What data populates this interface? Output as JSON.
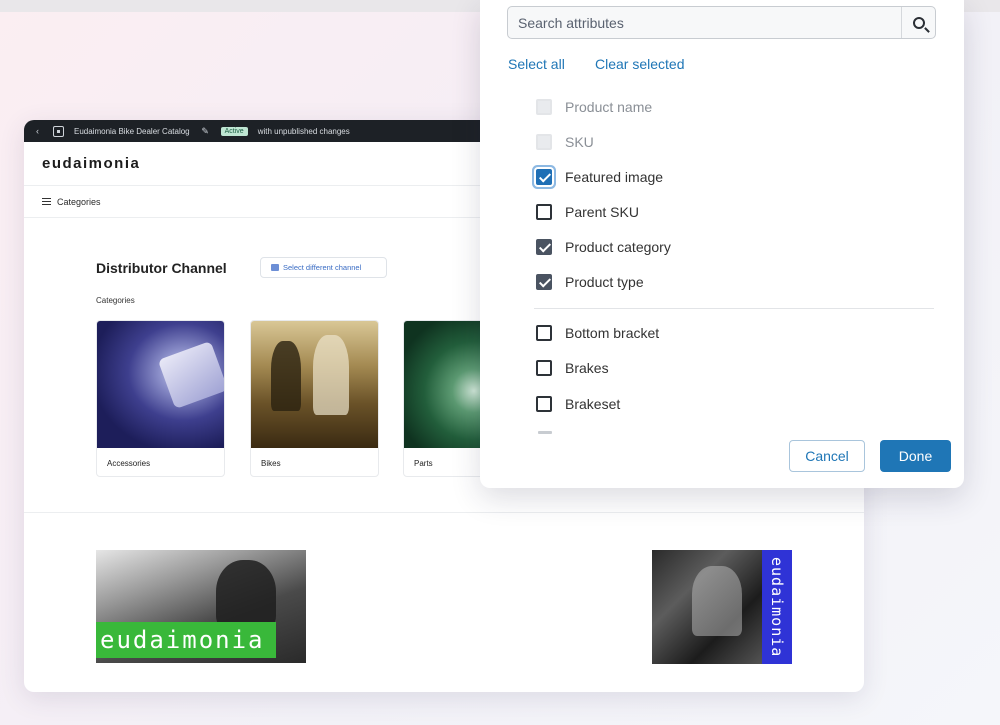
{
  "app": {
    "topbar": {
      "catalog_name": "Eudaimonia Bike Dealer Catalog",
      "status_badge": "Active",
      "status_note": "with unpublished changes"
    },
    "brand": "eudaimonia",
    "nav": {
      "categories_label": "Categories"
    },
    "channel": {
      "title": "Distributor Channel",
      "select_button": "Select different channel"
    },
    "categories_heading": "Categories",
    "categories": [
      {
        "label": "Accessories"
      },
      {
        "label": "Bikes"
      },
      {
        "label": "Parts"
      }
    ],
    "banner_left_logo": "eudaimonia",
    "banner_right_logo": "eudaimonia"
  },
  "panel": {
    "search": {
      "placeholder": "Search attributes",
      "value": ""
    },
    "select_all": "Select all",
    "clear_selected": "Clear selected",
    "attributes": [
      {
        "label": "Product name",
        "state": "disabled"
      },
      {
        "label": "SKU",
        "state": "disabled"
      },
      {
        "label": "Featured image",
        "state": "checked-focused"
      },
      {
        "label": "Parent SKU",
        "state": "unchecked"
      },
      {
        "label": "Product category",
        "state": "checked"
      },
      {
        "label": "Product type",
        "state": "checked"
      },
      {
        "label": "Bottom bracket",
        "state": "unchecked"
      },
      {
        "label": "Brakes",
        "state": "unchecked"
      },
      {
        "label": "Brakeset",
        "state": "unchecked"
      }
    ],
    "cancel_label": "Cancel",
    "done_label": "Done"
  },
  "colors": {
    "accent": "#1f76b6",
    "checkbox_checked": "#4a5361",
    "badge_bg": "#bfe6d3",
    "banner_green": "#39b83a",
    "banner_blue": "#2f33d6"
  }
}
